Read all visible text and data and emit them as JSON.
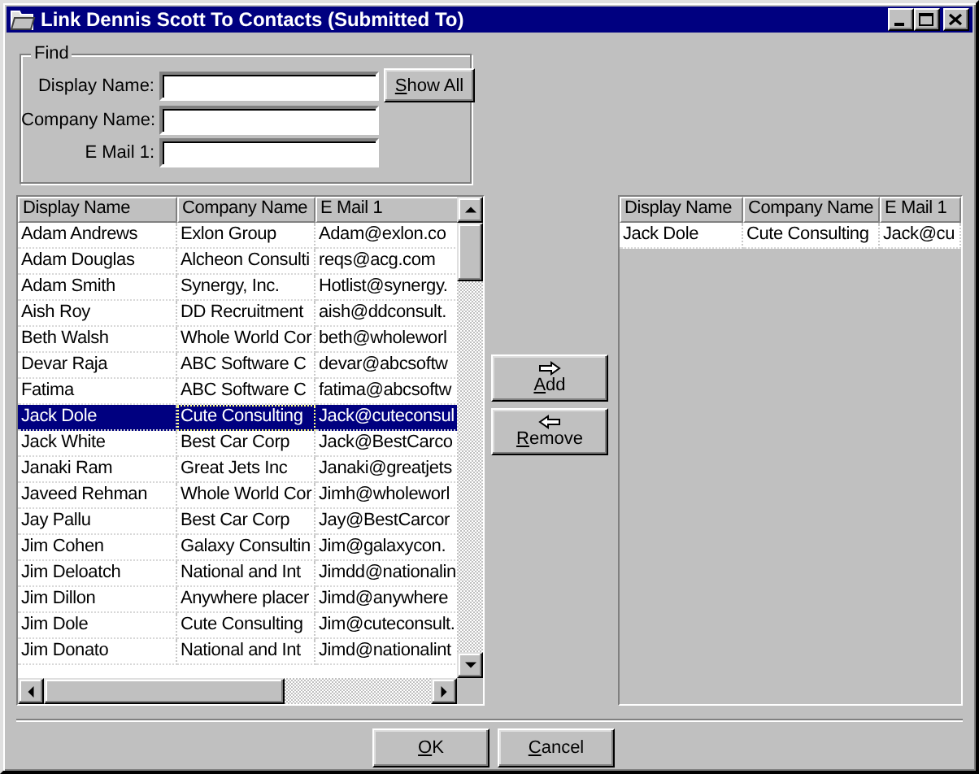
{
  "window": {
    "title": "Link Dennis Scott To Contacts (Submitted To)"
  },
  "find": {
    "label": "Find",
    "fields": [
      {
        "label": "Display Name:"
      },
      {
        "label": "Company Name:"
      },
      {
        "label": "E Mail 1:"
      }
    ],
    "button": "Show All"
  },
  "available": {
    "columns": [
      "Display Name",
      "Company Name",
      "E Mail 1"
    ],
    "rows": [
      {
        "cells": [
          "Adam Andrews",
          "Exlon Group",
          "Adam@exlon.co"
        ],
        "selected": false
      },
      {
        "cells": [
          "Adam Douglas",
          "Alcheon Consulti",
          "reqs@acg.com"
        ],
        "selected": false
      },
      {
        "cells": [
          "Adam Smith",
          "Synergy, Inc.",
          "Hotlist@synergy."
        ],
        "selected": false
      },
      {
        "cells": [
          "Aish Roy",
          "DD Recruitment",
          "aish@ddconsult."
        ],
        "selected": false
      },
      {
        "cells": [
          "Beth Walsh",
          "Whole World Cor",
          "beth@wholeworl"
        ],
        "selected": false
      },
      {
        "cells": [
          "Devar Raja",
          "ABC Software C",
          "devar@abcsoftw"
        ],
        "selected": false
      },
      {
        "cells": [
          "Fatima",
          "ABC Software C",
          "fatima@abcsoftw"
        ],
        "selected": false
      },
      {
        "cells": [
          "Jack Dole",
          "Cute Consulting",
          "Jack@cuteconsul"
        ],
        "selected": true
      },
      {
        "cells": [
          "Jack White",
          "Best Car Corp",
          "Jack@BestCarco"
        ],
        "selected": false
      },
      {
        "cells": [
          "Janaki Ram",
          "Great Jets Inc",
          "Janaki@greatjets"
        ],
        "selected": false
      },
      {
        "cells": [
          "Javeed Rehman",
          "Whole World Cor",
          "Jimh@wholeworl"
        ],
        "selected": false
      },
      {
        "cells": [
          "Jay Pallu",
          "Best Car Corp",
          "Jay@BestCarcor"
        ],
        "selected": false
      },
      {
        "cells": [
          "Jim Cohen",
          "Galaxy Consultin",
          "Jim@galaxycon."
        ],
        "selected": false
      },
      {
        "cells": [
          "Jim Deloatch",
          "National and Int",
          "Jimdd@nationalin"
        ],
        "selected": false
      },
      {
        "cells": [
          "Jim Dillon",
          "Anywhere placer",
          "Jimd@anywhere"
        ],
        "selected": false
      },
      {
        "cells": [
          "Jim Dole",
          "Cute Consulting",
          "Jim@cuteconsult."
        ],
        "selected": false
      },
      {
        "cells": [
          "Jim Donato",
          "National and Int",
          "Jimd@nationalint"
        ],
        "selected": false
      }
    ]
  },
  "actions": [
    {
      "kind": "add",
      "label": "Add"
    },
    {
      "kind": "remove",
      "label": "Remove"
    }
  ],
  "linked": {
    "columns": [
      "Display Name",
      "Company Name",
      "E Mail 1"
    ],
    "rows": [
      {
        "cells": [
          "Jack Dole",
          "Cute Consulting",
          "Jack@cu"
        ],
        "selected": false
      }
    ]
  },
  "buttons": [
    "OK",
    "Cancel"
  ]
}
